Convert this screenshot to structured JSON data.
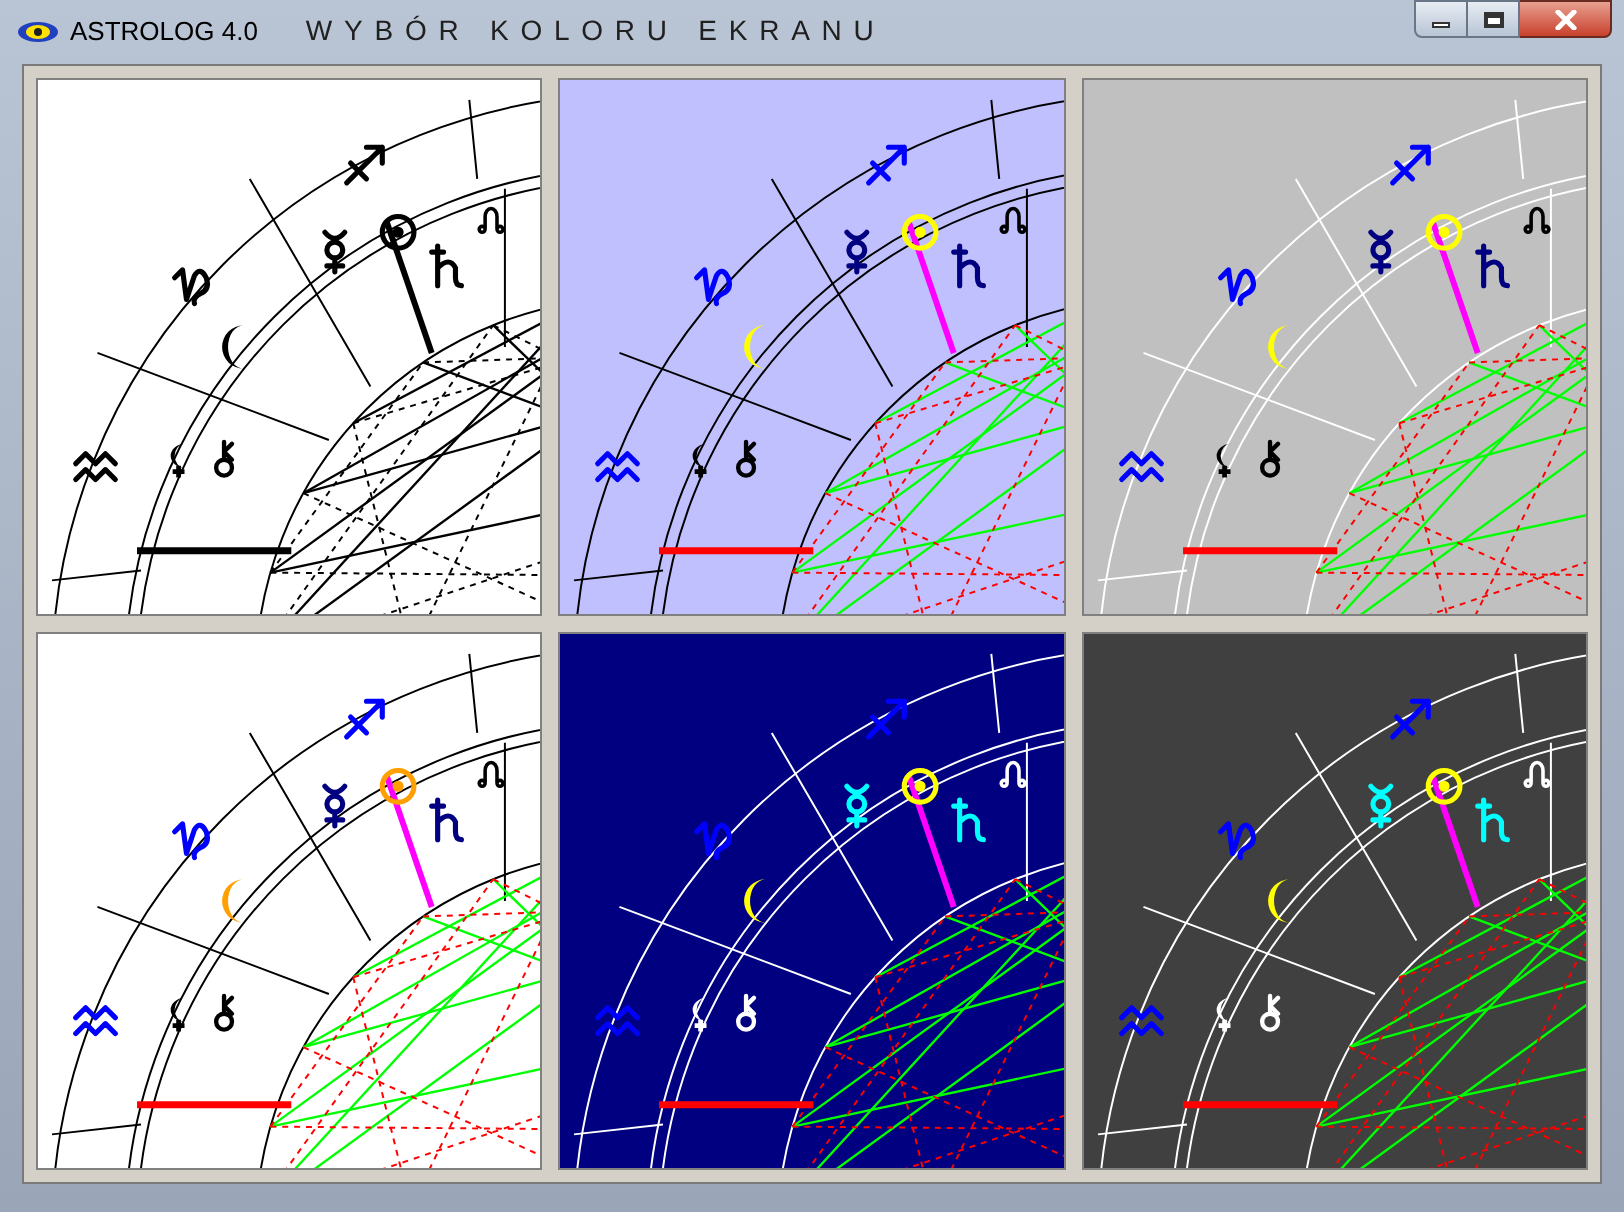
{
  "window": {
    "title": "ASTROLOG 4.0",
    "subtitle": "WYBÓR KOLORU EKRANU"
  },
  "panels": [
    {
      "kind": "mono"
    },
    {
      "kind": "lavender"
    },
    {
      "kind": "gray"
    },
    {
      "kind": "white"
    },
    {
      "kind": "navy"
    },
    {
      "kind": "dark"
    }
  ]
}
